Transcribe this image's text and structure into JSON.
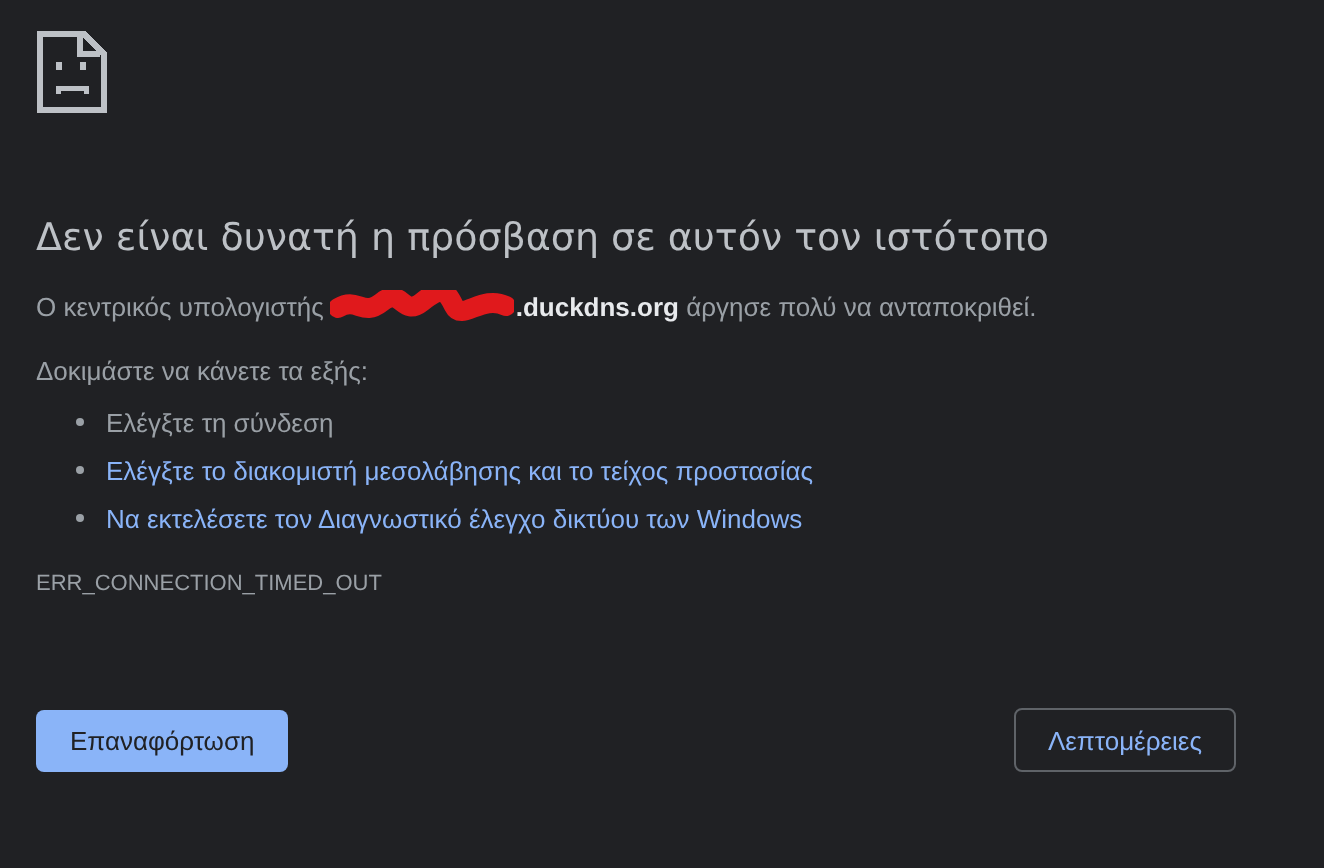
{
  "heading": "Δεν είναι δυνατή η πρόσβαση σε αυτόν τον ιστότοπο",
  "message_before": "Ο κεντρικός υπολογιστής",
  "message_after": "**.duckdns.org** άργησε πολύ να ανταποκριθεί.",
  "suggestions_heading": "Δοκιμάστε να κάνετε τα εξής:",
  "suggestions": [
    {
      "kind": "text",
      "text": "Ελέγξτε τη σύνδεση"
    },
    {
      "kind": "link",
      "text": "Ελέγξτε το διακομιστή μεσολάβησης και το τείχος προστασίας"
    },
    {
      "kind": "link",
      "text": "Να εκτελέσετε τον Διαγνωστικό έλεγχο δικτύου των Windows"
    }
  ],
  "error_code": "ERR_CONNECTION_TIMED_OUT",
  "buttons": [
    {
      "kind": "primary",
      "label": "Επαναφόρτωση"
    },
    {
      "kind": "secondary",
      "label": "Λεπτομέρειες"
    }
  ]
}
